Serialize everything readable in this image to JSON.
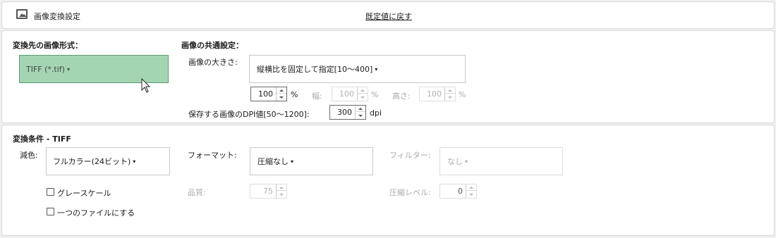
{
  "header": {
    "title": "画像変換設定",
    "reset_link": "既定値に戻す"
  },
  "output_format": {
    "heading": "変換先の画像形式：",
    "selected": "TIFF (*.tif)"
  },
  "common": {
    "heading": "画像の共通設定：",
    "size_label": "画像の大きさ:",
    "size_mode": "縦横比を固定して指定[10～400]",
    "scale_value": "100",
    "scale_unit": "%",
    "width_label": "幅:",
    "width_value": "100",
    "width_unit": "%",
    "height_label": "高さ:",
    "height_value": "100",
    "height_unit": "%",
    "dpi_label": "保存する画像のDPI値[50～1200]:",
    "dpi_value": "300",
    "dpi_unit": "dpi"
  },
  "conversion": {
    "heading": "変換条件 - TIFF",
    "color_label": "減色:",
    "color_value": "フルカラー(24ビット)",
    "format_label": "フォーマット:",
    "format_value": "圧縮なし",
    "filter_label": "フィルター:",
    "filter_value": "なし",
    "grayscale_label": "グレースケール",
    "single_file_label": "一つのファイルにする",
    "quality_label": "品質:",
    "quality_value": "75",
    "compression_label": "圧縮レベル:",
    "compression_value": "0"
  },
  "colors": {
    "selected_format_bg": "#a3d5b2",
    "selected_format_border": "#5c9c73"
  },
  "icons": {
    "header": "image-icon",
    "pointer": "mouse-cursor-icon"
  }
}
